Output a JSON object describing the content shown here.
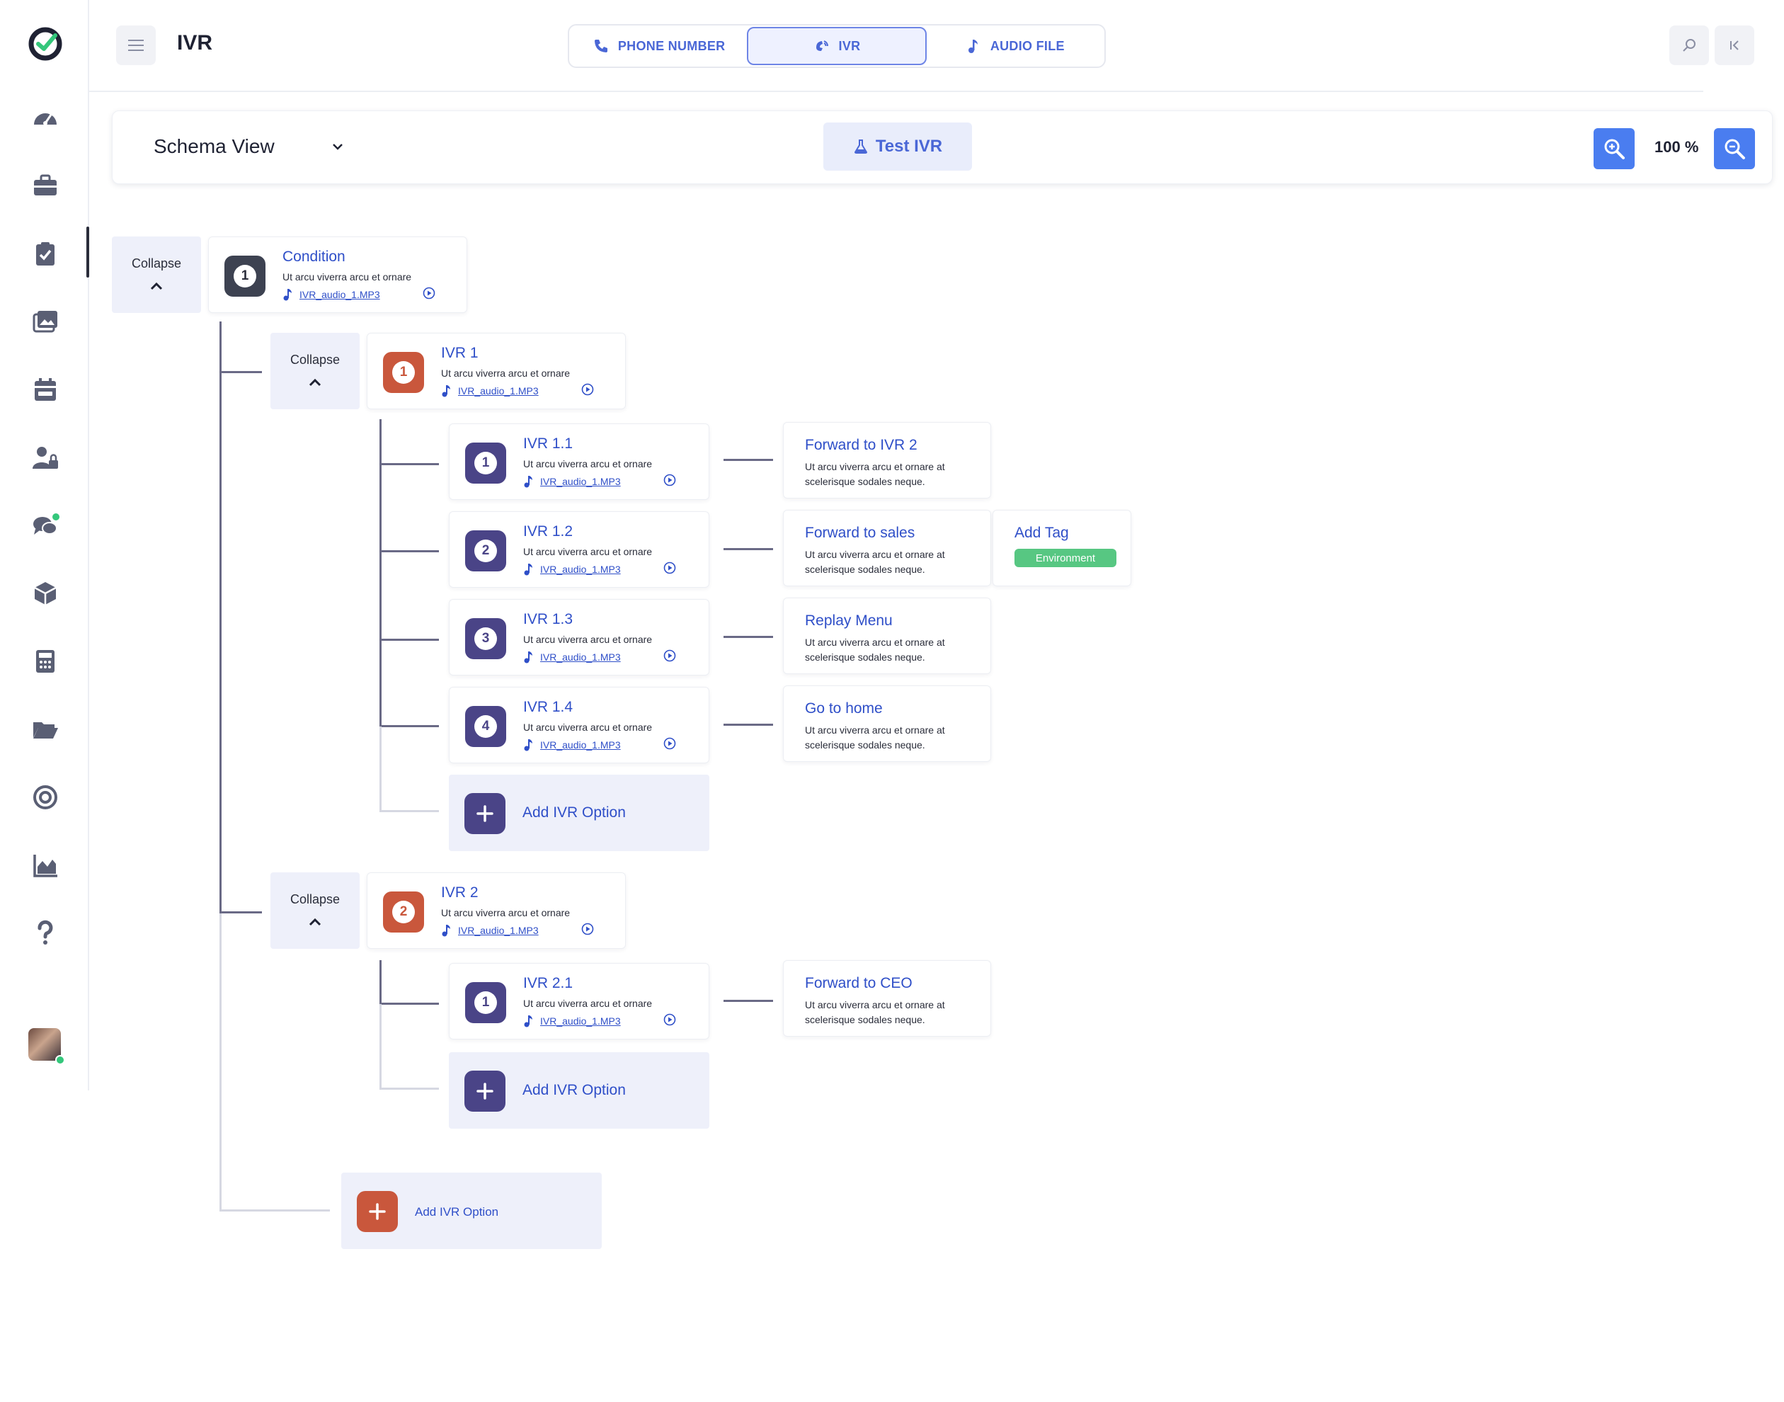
{
  "header": {
    "title": "IVR",
    "tabs": [
      {
        "label": "PHONE NUMBER",
        "icon": "phone-icon"
      },
      {
        "label": "IVR",
        "icon": "ivr-icon",
        "active": true
      },
      {
        "label": "AUDIO FILE",
        "icon": "music-note-icon"
      }
    ]
  },
  "toolbar": {
    "view_label": "Schema View",
    "test_label": "Test IVR",
    "zoom": "100 %"
  },
  "colors": {
    "accent": "#4a67d6",
    "zoom_button": "#4a7df0",
    "badge_dark": "#3d4251",
    "badge_orange": "#c9573c",
    "badge_purple": "#4a4487",
    "tag_green": "#57c782"
  },
  "collapse_label": "Collapse",
  "tree": {
    "condition": {
      "num": "1",
      "title": "Condition",
      "desc": "Ut arcu viverra arcu et ornare",
      "audio": "IVR_audio_1.MP3"
    },
    "ivr1": {
      "num": "1",
      "title": "IVR 1",
      "desc": "Ut arcu viverra arcu et ornare",
      "audio": "IVR_audio_1.MP3",
      "options": [
        {
          "num": "1",
          "title": "IVR 1.1",
          "desc": "Ut arcu viverra arcu et ornare",
          "audio": "IVR_audio_1.MP3",
          "action": {
            "title": "Forward to IVR 2",
            "desc": "Ut arcu viverra arcu et ornare at scelerisque sodales neque."
          }
        },
        {
          "num": "2",
          "title": "IVR 1.2",
          "desc": "Ut arcu viverra arcu et ornare",
          "audio": "IVR_audio_1.MP3",
          "action": {
            "title": "Forward to sales",
            "desc": "Ut arcu viverra arcu et ornare at scelerisque sodales neque."
          },
          "tag": {
            "title": "Add Tag",
            "value": "Environment"
          }
        },
        {
          "num": "3",
          "title": "IVR 1.3",
          "desc": "Ut arcu viverra arcu et ornare",
          "audio": "IVR_audio_1.MP3",
          "action": {
            "title": "Replay Menu",
            "desc": "Ut arcu viverra arcu et ornare at scelerisque sodales neque."
          }
        },
        {
          "num": "4",
          "title": "IVR 1.4",
          "desc": "Ut arcu viverra arcu et ornare",
          "audio": "IVR_audio_1.MP3",
          "action": {
            "title": "Go to home",
            "desc": "Ut arcu viverra arcu et ornare at scelerisque sodales neque."
          }
        }
      ],
      "add_label": "Add IVR Option"
    },
    "ivr2": {
      "num": "2",
      "title": "IVR 2",
      "desc": "Ut arcu viverra arcu et ornare",
      "audio": "IVR_audio_1.MP3",
      "options": [
        {
          "num": "1",
          "title": "IVR 2.1",
          "desc": "Ut arcu viverra arcu et ornare",
          "audio": "IVR_audio_1.MP3",
          "action": {
            "title": "Forward to CEO",
            "desc": "Ut arcu viverra arcu et ornare at scelerisque sodales neque."
          }
        }
      ],
      "add_label": "Add IVR Option"
    },
    "root_add_label": "Add IVR Option"
  }
}
